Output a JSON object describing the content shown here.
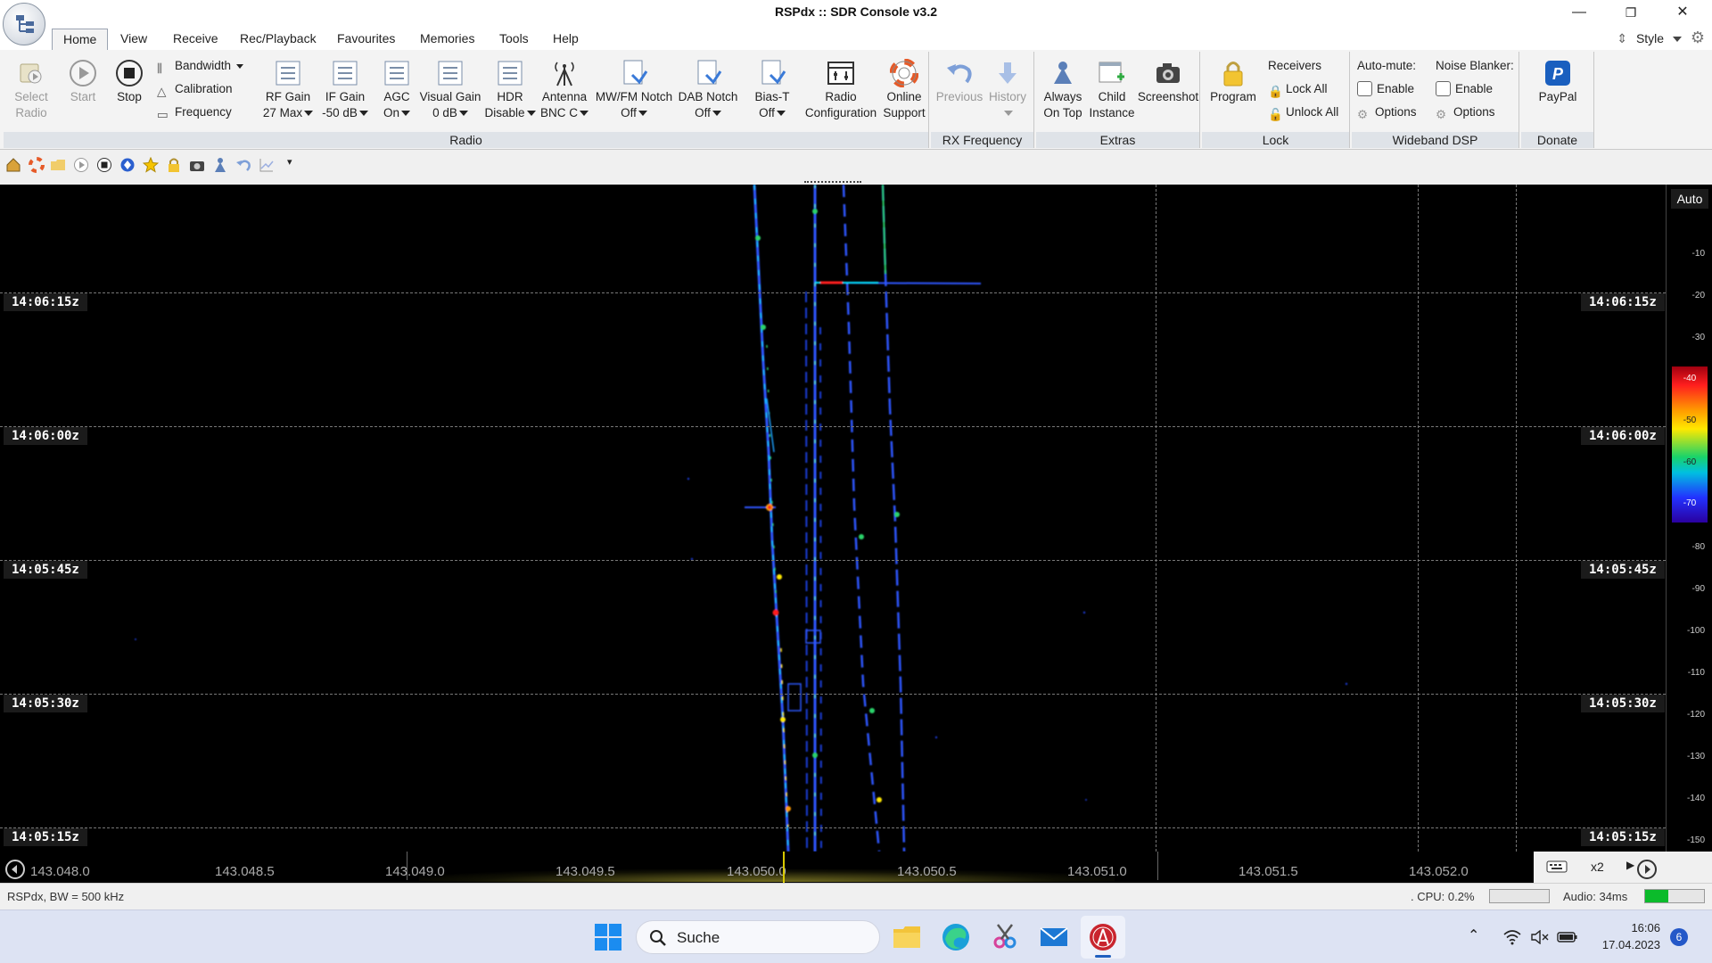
{
  "window": {
    "title": "RSPdx :: SDR Console v3.2",
    "minimize": "—",
    "restore": "❐",
    "close": "✕"
  },
  "menu": {
    "tabs": [
      "Home",
      "View",
      "Receive",
      "Rec/Playback",
      "Favourites",
      "Memories",
      "Tools",
      "Help"
    ],
    "style_label": "Style"
  },
  "ribbon": {
    "radio": {
      "label": "Radio",
      "select_radio": [
        "Select",
        "Radio"
      ],
      "start": "Start",
      "stop": "Stop",
      "bandwidth": "Bandwidth",
      "calibration": "Calibration",
      "frequency": "Frequency",
      "rf_gain": [
        "RF Gain",
        "27 Max"
      ],
      "if_gain": [
        "IF Gain",
        "-50 dB"
      ],
      "agc": [
        "AGC",
        "On"
      ],
      "visual_gain": [
        "Visual Gain",
        "0 dB"
      ],
      "hdr": [
        "HDR",
        "Disable"
      ],
      "antenna": [
        "Antenna",
        "BNC C"
      ],
      "mwfm_notch": [
        "MW/FM Notch",
        "Off"
      ],
      "dab_notch": [
        "DAB Notch",
        "Off"
      ],
      "bias_t": [
        "Bias-T",
        "Off"
      ],
      "radio_config": [
        "Radio",
        "Configuration"
      ],
      "online_support": [
        "Online",
        "Support"
      ]
    },
    "rx_frequency": {
      "label": "RX Frequency",
      "previous": "Previous",
      "history": "History"
    },
    "extras": {
      "label": "Extras",
      "always_on_top": [
        "Always",
        "On Top"
      ],
      "child_instance": [
        "Child",
        "Instance"
      ],
      "screenshot": "Screenshot"
    },
    "lock": {
      "label": "Lock",
      "program": "Program",
      "receivers": "Receivers",
      "lock_all": "Lock All",
      "unlock_all": "Unlock All"
    },
    "wideband_dsp": {
      "label": "Wideband DSP",
      "auto_mute": "Auto-mute:",
      "noise_blanker": "Noise Blanker:",
      "enable": "Enable",
      "options": "Options"
    },
    "donate": {
      "label": "Donate",
      "paypal": "PayPal"
    }
  },
  "waterfall": {
    "timestamps": [
      "14:06:15z",
      "14:06:00z",
      "14:05:45z",
      "14:05:30z",
      "14:05:15z"
    ],
    "db_auto": "Auto",
    "db_labels": [
      "-10",
      "-20",
      "-30",
      "-40",
      "-50",
      "-60",
      "-70",
      "-80",
      "-90",
      "-100",
      "-110",
      "-120",
      "-130",
      "-140",
      "-150"
    ],
    "frequencies": [
      "143.048.0",
      "143.048.5",
      "143.049.0",
      "143.049.5",
      "143.050.0",
      "143.050.5",
      "143.051.0",
      "143.051.5",
      "143.052.0"
    ],
    "zoom": "x2"
  },
  "status": {
    "left": "RSPdx, BW = 500 kHz",
    "cpu": ". CPU: 0.2%",
    "audio": "Audio: 34ms"
  },
  "taskbar": {
    "search": "Suche",
    "time": "16:06",
    "date": "17.04.2023",
    "notifications": "6"
  },
  "colors": {
    "accent": "#1f5fbf",
    "waterfall_bg": "#000000",
    "signal_blue": "#2f56ff",
    "signal_green": "#2bd36a",
    "signal_yellow": "#ffe800",
    "signal_red": "#ff1e1e"
  }
}
